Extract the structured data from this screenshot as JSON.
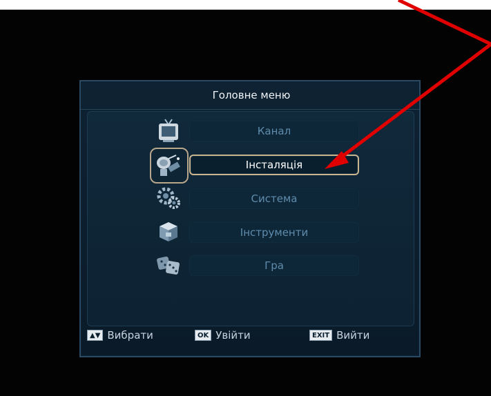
{
  "header": {
    "title": "Головне меню"
  },
  "menu": {
    "items": [
      {
        "label": "Канал",
        "icon": "tv-icon"
      },
      {
        "label": "Інсталяція",
        "icon": "satellite-icon"
      },
      {
        "label": "Система",
        "icon": "gears-icon"
      },
      {
        "label": "Інструменти",
        "icon": "toolbox-icon"
      },
      {
        "label": "Гра",
        "icon": "dice-icon"
      }
    ],
    "selected_index": 1
  },
  "footer": {
    "select_key": "▲▼",
    "select_label": "Вибрати",
    "ok_key": "OK",
    "ok_label": "Увійти",
    "exit_key": "EXIT",
    "exit_label": "Вийти"
  },
  "annotation_color": "#e00000"
}
